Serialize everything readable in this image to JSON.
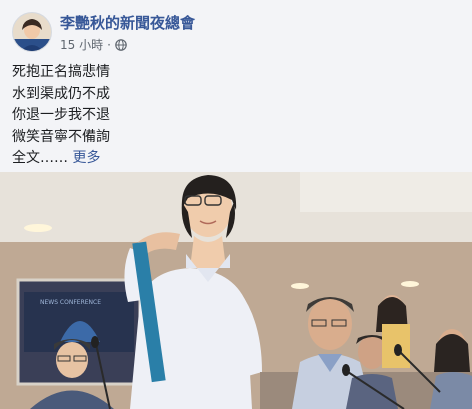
{
  "page": {
    "name": "李艷秋的新聞夜總會",
    "timestamp": "15 小時",
    "separator": "·",
    "privacy_icon": "globe-icon"
  },
  "post": {
    "lines": [
      "死抱正名搞悲情",
      "水到渠成仍不成",
      "你退一步我不退",
      "微笑音寧不備詢"
    ],
    "truncated_prefix": "全文……",
    "see_more_label": "更多"
  },
  "image": {
    "inset_screen_text": "NEWS CONFERENCE",
    "icon": "photo"
  },
  "colors": {
    "link_blue": "#385898",
    "meta_gray": "#606770",
    "text": "#1c1e21",
    "background": "#f3f4f7"
  }
}
